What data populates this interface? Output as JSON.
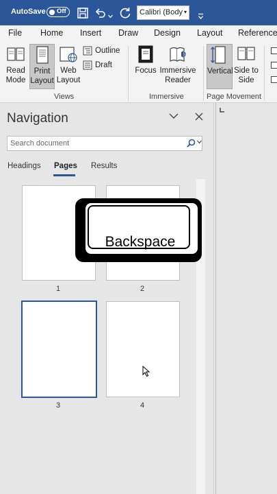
{
  "titlebar": {
    "autosave_label": "AutoSave",
    "autosave_state": "Off",
    "font_name": "Calibri (Body",
    "icons": [
      "save-icon",
      "undo-icon",
      "redo-icon",
      "customize-toolbar-icon"
    ]
  },
  "tabs": [
    "File",
    "Home",
    "Insert",
    "Draw",
    "Design",
    "Layout",
    "References"
  ],
  "ribbon": {
    "views": {
      "read_mode": "Read Mode",
      "print_layout": "Print Layout",
      "web_layout": "Web Layout",
      "outline": "Outline",
      "draft": "Draft",
      "group_label": "Views"
    },
    "immersive": {
      "focus": "Focus",
      "immersive_reader": "Immersive Reader",
      "group_label": "Immersive"
    },
    "page_movement": {
      "vertical": "Vertical",
      "side_to_side": "Side to Side",
      "group_label": "Page Movement"
    }
  },
  "nav": {
    "title": "Navigation",
    "search_placeholder": "Search document",
    "tabs": [
      "Headings",
      "Pages",
      "Results"
    ],
    "active_tab": "Pages",
    "pages": [
      {
        "number": "1",
        "selected": false
      },
      {
        "number": "2",
        "selected": false
      },
      {
        "number": "3",
        "selected": true
      },
      {
        "number": "4",
        "selected": false
      }
    ]
  },
  "overlay": {
    "key_label": "Backspace"
  },
  "colors": {
    "title_bar": "#2b579a",
    "accent": "#2b579a",
    "ribbon_bg": "#f3f3f3",
    "pane_bg": "#e6e6e6"
  }
}
